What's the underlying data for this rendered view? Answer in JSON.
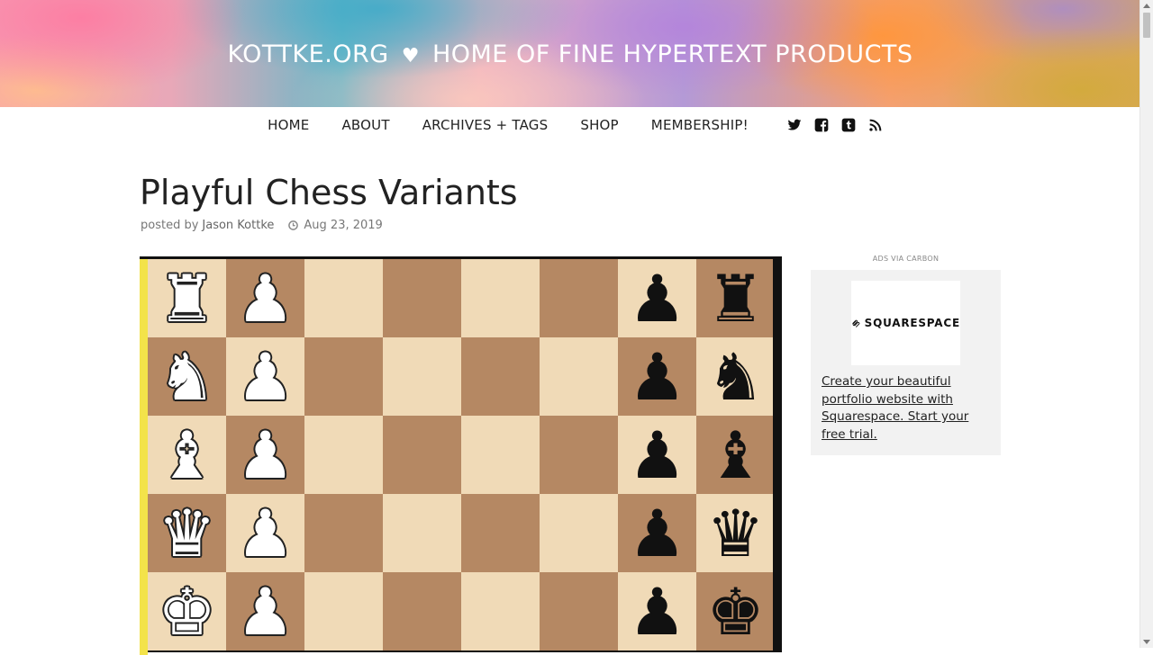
{
  "header": {
    "site_name": "KOTTKE.ORG",
    "heart": "♥",
    "tagline": "HOME OF FINE HYPERTEXT PRODUCTS"
  },
  "nav": {
    "items": [
      {
        "label": "HOME"
      },
      {
        "label": "ABOUT"
      },
      {
        "label": "ARCHIVES + TAGS"
      },
      {
        "label": "SHOP"
      },
      {
        "label": "MEMBERSHIP!"
      }
    ],
    "social_icons": [
      "twitter-icon",
      "facebook-icon",
      "tumblr-icon",
      "rss-icon"
    ]
  },
  "post": {
    "title": "Playful Chess Variants",
    "posted_by": "posted by",
    "author": "Jason Kottke",
    "date": "Aug 23, 2019"
  },
  "chess_board": {
    "rows": [
      [
        "♜",
        "♟",
        "",
        "",
        "",
        "",
        "♟",
        "♜"
      ],
      [
        "♞",
        "♟",
        "",
        "",
        "",
        "",
        "♟",
        "♞"
      ],
      [
        "♝",
        "♟",
        "",
        "",
        "",
        "",
        "♟",
        "♝"
      ],
      [
        "♛",
        "♟",
        "",
        "",
        "",
        "",
        "♟",
        "♛"
      ],
      [
        "♚",
        "♟",
        "",
        "",
        "",
        "",
        "♟",
        "♚"
      ]
    ],
    "piece_colors": [
      "white",
      "white",
      "",
      "",
      "",
      "",
      "black",
      "black"
    ],
    "light_color": "#f0dab7",
    "dark_color": "#b58863"
  },
  "ad": {
    "label": "ADS VIA CARBON",
    "brand": "SQUARESPACE",
    "text": "Create your beautiful portfolio website with Squarespace. Start your free trial."
  }
}
